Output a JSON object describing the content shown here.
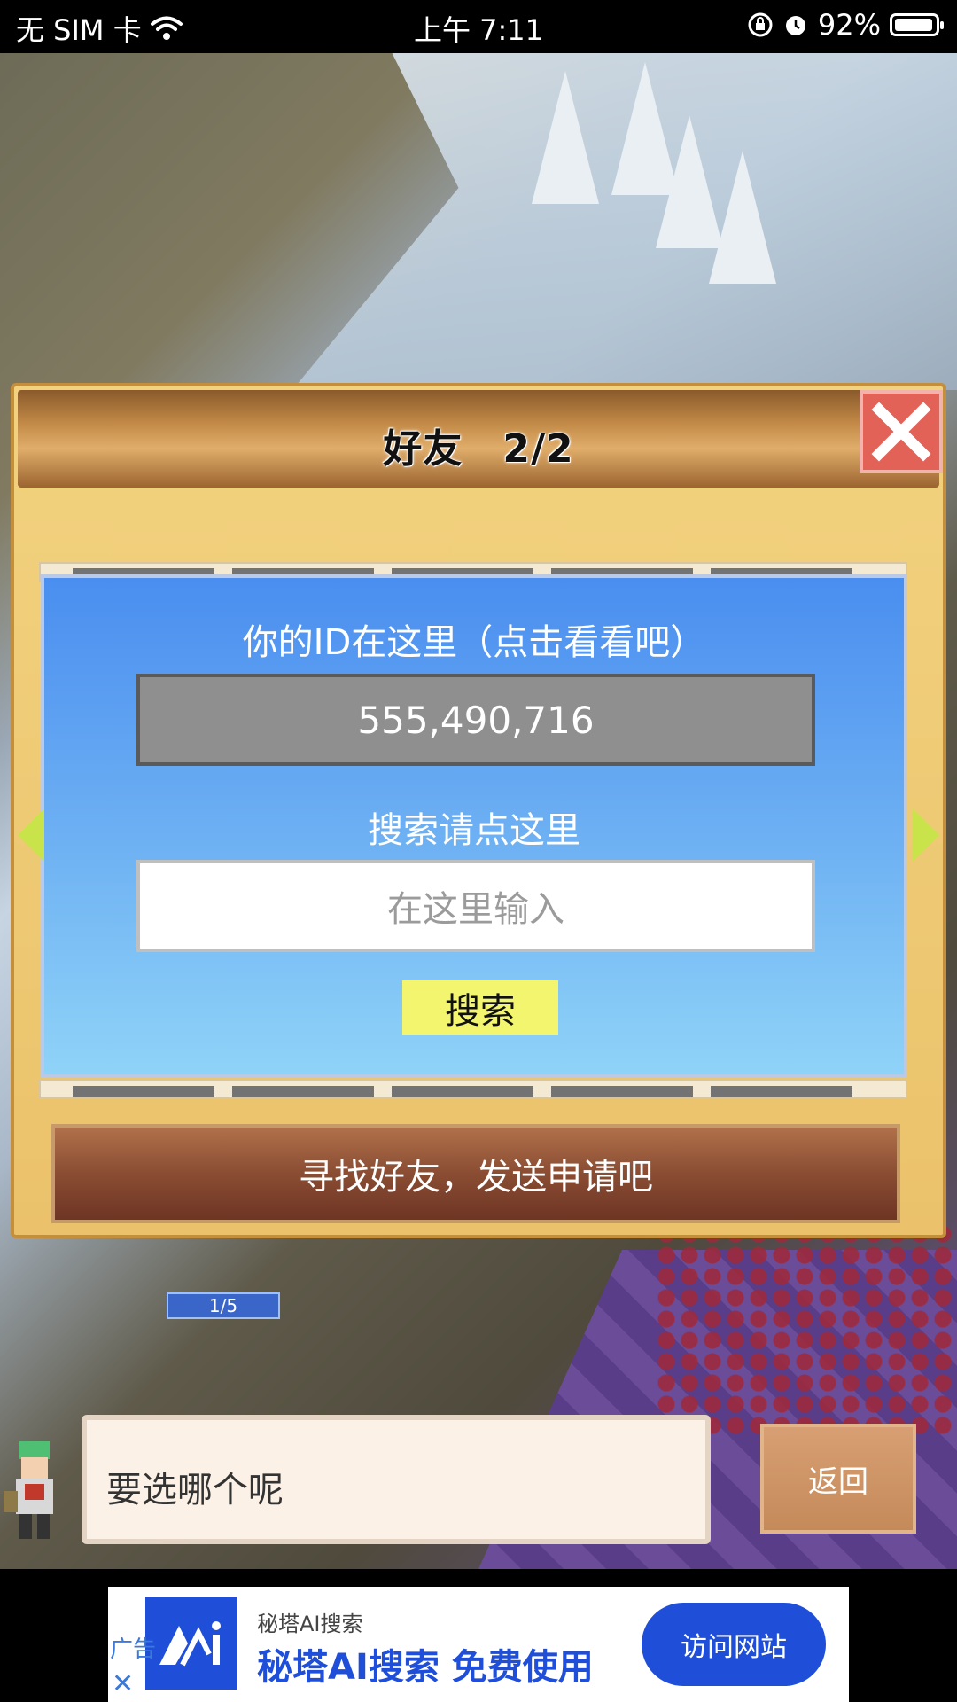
{
  "status_bar": {
    "carrier": "无 SIM 卡",
    "time": "上午 7:11",
    "battery": "92%",
    "icons": [
      "wifi-icon",
      "orientation-lock-icon",
      "alarm-icon",
      "battery-icon"
    ]
  },
  "dialog": {
    "title": "好友　2/2",
    "close_icon": "close-icon",
    "id_caption": "你的ID在这里（点击看看吧）",
    "id_value": "555,490,716",
    "search_caption": "搜索请点这里",
    "search_placeholder": "在这里输入",
    "search_button": "搜索",
    "find_friends_label": "寻找好友，发送申请吧"
  },
  "scene": {
    "progress_tag": "1/5"
  },
  "bottom": {
    "speech": "要选哪个呢",
    "back_button": "返回"
  },
  "ad": {
    "label": "广告",
    "small_title": "秘塔AI搜索",
    "title": "秘塔AI搜索 免费使用",
    "button": "访问网站",
    "close": "✕"
  },
  "colors": {
    "accent_blue": "#4a8ef0",
    "close_red": "#e26258",
    "search_button_yellow": "#f4f56e",
    "ad_blue": "#1f4fd8"
  }
}
